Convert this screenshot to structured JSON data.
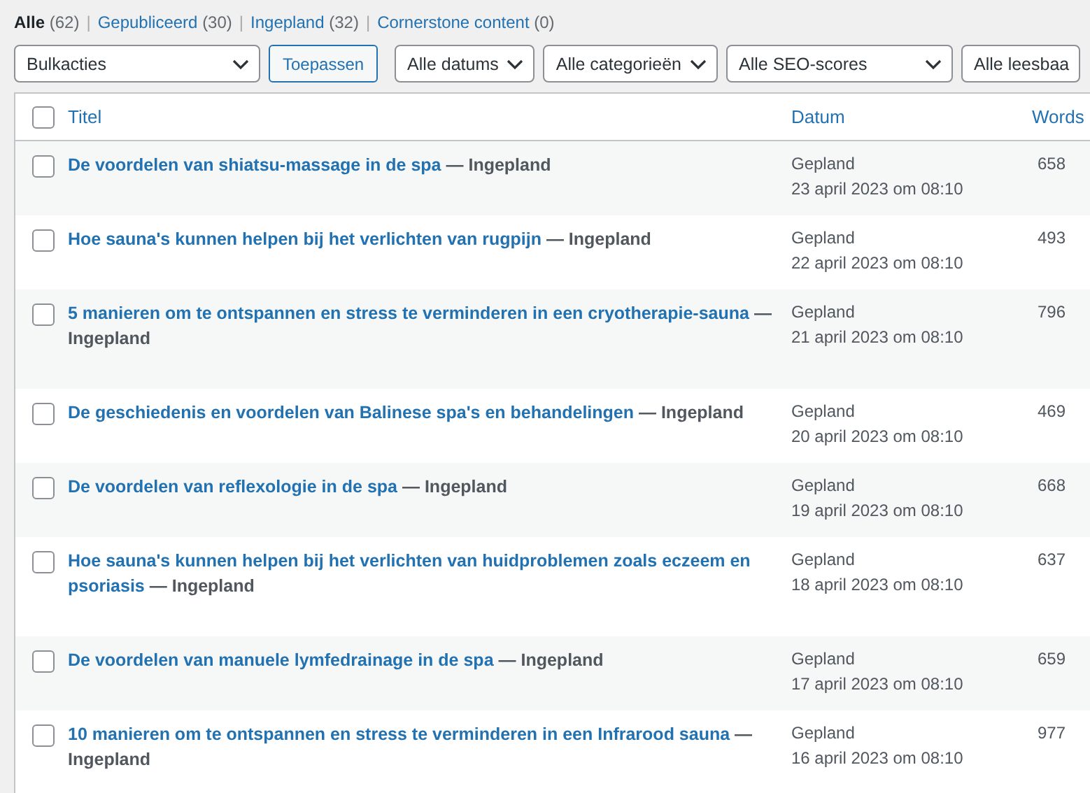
{
  "views": [
    {
      "label": "Alle",
      "count": "(62)",
      "selected": true
    },
    {
      "label": "Gepubliceerd",
      "count": "(30)",
      "selected": false
    },
    {
      "label": "Ingepland",
      "count": "(32)",
      "selected": false
    },
    {
      "label": "Cornerstone content",
      "count": "(0)",
      "selected": false
    }
  ],
  "view_separator": "|",
  "filters": [
    {
      "kind": "select",
      "label": "Bulkacties"
    },
    {
      "kind": "button",
      "label": "Toepassen"
    },
    {
      "kind": "select",
      "label": "Alle datums"
    },
    {
      "kind": "select",
      "label": "Alle categorieën"
    },
    {
      "kind": "select",
      "label": "Alle SEO-scores"
    },
    {
      "kind": "select",
      "label": "Alle leesbaa"
    }
  ],
  "table": {
    "select_all_checked": false,
    "columns": [
      "Titel",
      "Datum",
      "Words"
    ],
    "rows": [
      {
        "checked": false,
        "title": "De voordelen van shiatsu-massage in de spa",
        "state": "— Ingepland",
        "status": "Gepland",
        "date": "23 april 2023 om 08:10",
        "words": "658"
      },
      {
        "checked": false,
        "title": "Hoe sauna's kunnen helpen bij het verlichten van rugpijn",
        "state": "— Ingepland",
        "status": "Gepland",
        "date": "22 april 2023 om 08:10",
        "words": "493"
      },
      {
        "checked": false,
        "title": "5 manieren om te ontspannen en stress te verminderen in een cryotherapie-sauna",
        "state": "— Ingepland",
        "status": "Gepland",
        "date": "21 april 2023 om 08:10",
        "words": "796"
      },
      {
        "checked": false,
        "title": "De geschiedenis en voordelen van Balinese spa's en behandelingen",
        "state": "— Ingepland",
        "status": "Gepland",
        "date": "20 april 2023 om 08:10",
        "words": "469"
      },
      {
        "checked": false,
        "title": "De voordelen van reflexologie in de spa",
        "state": "— Ingepland",
        "status": "Gepland",
        "date": "19 april 2023 om 08:10",
        "words": "668"
      },
      {
        "checked": false,
        "title": "Hoe sauna's kunnen helpen bij het verlichten van huidproblemen zoals eczeem en psoriasis",
        "state": "— Ingepland",
        "status": "Gepland",
        "date": "18 april 2023 om 08:10",
        "words": "637"
      },
      {
        "checked": false,
        "title": "De voordelen van manuele lymfedrainage in de spa",
        "state": "— Ingepland",
        "status": "Gepland",
        "date": "17 april 2023 om 08:10",
        "words": "659"
      },
      {
        "checked": false,
        "title": "10 manieren om te ontspannen en stress te verminderen in een Infrarood sauna",
        "state": "— Ingepland",
        "status": "Gepland",
        "date": "16 april 2023 om 08:10",
        "words": "977"
      }
    ]
  }
}
